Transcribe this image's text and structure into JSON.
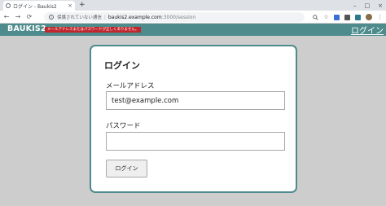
{
  "browser": {
    "tab_title": "ログイン - Baukis2",
    "tab_close": "×",
    "new_tab": "+",
    "window_controls": [
      "–",
      "□",
      "×"
    ],
    "nav": {
      "back": "←",
      "forward": "→",
      "reload": "⟳"
    },
    "security_text": "保護されていない通信",
    "url_host": "baukis2.example.com",
    "url_path": ":3000/session",
    "toolbar_icons": [
      "zoom-icon",
      "star-icon",
      "extension-icon",
      "extension-icon",
      "extension-icon",
      "avatar",
      "menu-icon"
    ]
  },
  "header": {
    "app_name": "BAUKIS2",
    "alert": "メールアドレスまたはパスワードが正しくありません。",
    "login_link": "ログイン"
  },
  "login": {
    "title": "ログイン",
    "email_label": "メールアドレス",
    "email_value": "test@example.com",
    "password_label": "パスワード",
    "password_value": "",
    "submit_label": "ログイン"
  },
  "colors": {
    "header": "#4e8b8d",
    "alert": "#c0272d",
    "background": "#cdcdcd"
  }
}
